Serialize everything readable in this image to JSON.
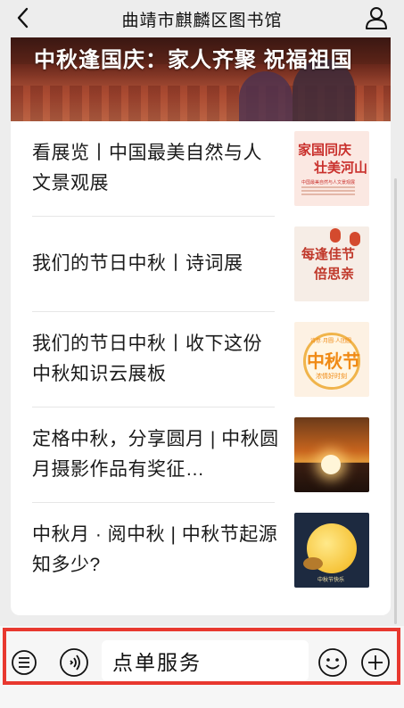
{
  "navbar": {
    "title": "曲靖市麒麟区图书馆"
  },
  "banner": {
    "title": "中秋逢国庆：家人齐聚 祝福祖国"
  },
  "articles": [
    {
      "title": "看展览丨中国最美自然与人文景观展",
      "thumb": {
        "line1": "家国同庆",
        "line2": "壮美河山",
        "caption": "中国最美自然与人文景观展"
      }
    },
    {
      "title": "我们的节日中秋丨诗词展",
      "thumb": {
        "line1": "每逢佳节",
        "line2": "倍思亲"
      }
    },
    {
      "title": "我们的节日中秋丨收下这份中秋知识云展板",
      "thumb": {
        "top": "诗意·月圆·人团圆",
        "line1": "中秋节",
        "line2": "浓情好时刻"
      }
    },
    {
      "title": "定格中秋，分享圆月 | 中秋圆月摄影作品有奖征…",
      "thumb": {}
    },
    {
      "title": "中秋月 · 阅中秋 | 中秋节起源知多少?",
      "thumb": {
        "caption": "中秋节快乐"
      }
    }
  ],
  "bottom_bar": {
    "service_label": "点单服务",
    "highlight_color": "#e8382f"
  },
  "icons": {
    "back": "chevron-left-icon",
    "user": "user-icon",
    "menu": "list-menu-icon",
    "voice": "voice-icon",
    "emoji": "emoji-icon",
    "plus": "plus-icon"
  }
}
